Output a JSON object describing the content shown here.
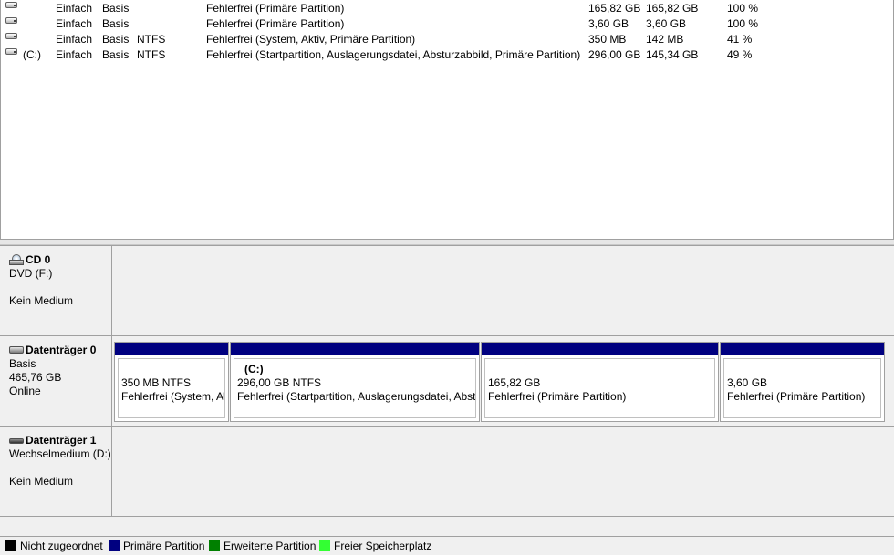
{
  "volumes": [
    {
      "name": "",
      "layout": "Einfach",
      "type": "Basis",
      "fs": "",
      "status": "Fehlerfrei (Primäre Partition)",
      "capacity": "165,82 GB",
      "free": "165,82 GB",
      "pct": "100 %"
    },
    {
      "name": "",
      "layout": "Einfach",
      "type": "Basis",
      "fs": "",
      "status": "Fehlerfrei (Primäre Partition)",
      "capacity": "3,60 GB",
      "free": "3,60 GB",
      "pct": "100 %"
    },
    {
      "name": "",
      "layout": "Einfach",
      "type": "Basis",
      "fs": "NTFS",
      "status": "Fehlerfrei (System, Aktiv, Primäre Partition)",
      "capacity": "350 MB",
      "free": "142 MB",
      "pct": "41 %"
    },
    {
      "name": "(C:)",
      "layout": "Einfach",
      "type": "Basis",
      "fs": "NTFS",
      "status": "Fehlerfrei (Startpartition, Auslagerungsdatei, Absturzabbild, Primäre Partition)",
      "capacity": "296,00 GB",
      "free": "145,34 GB",
      "pct": "49 %"
    }
  ],
  "disks": {
    "cd0": {
      "title": "CD 0",
      "drive": "DVD (F:)",
      "media": "Kein Medium",
      "icon": "cd-drive-icon"
    },
    "disk0": {
      "title": "Datenträger 0",
      "type": "Basis",
      "size": "465,76 GB",
      "state": "Online",
      "icon": "hard-disk-icon",
      "partitions": [
        {
          "name": "",
          "size": "350 MB NTFS",
          "status": "Fehlerfrei (System, Aktiv, Primäre Partition)"
        },
        {
          "name": "(C:)",
          "size": "296,00 GB NTFS",
          "status": "Fehlerfrei (Startpartition, Auslagerungsdatei, Absturzabbild, Primäre Partition)"
        },
        {
          "name": "",
          "size": "165,82 GB",
          "status": "Fehlerfrei (Primäre Partition)"
        },
        {
          "name": "",
          "size": "3,60 GB",
          "status": "Fehlerfrei (Primäre Partition)"
        }
      ]
    },
    "disk1": {
      "title": "Datenträger 1",
      "drive": "Wechselmedium (D:)",
      "media": "Kein Medium",
      "icon": "removable-disk-icon"
    }
  },
  "legend": [
    {
      "label": "Nicht zugeordnet",
      "color": "#000000"
    },
    {
      "label": "Primäre Partition",
      "color": "#000080"
    },
    {
      "label": "Erweiterte Partition",
      "color": "#008000"
    },
    {
      "label": "Freier Speicherplatz",
      "color": "#33ff33"
    }
  ],
  "colors": {
    "partition_header": "#000080"
  }
}
